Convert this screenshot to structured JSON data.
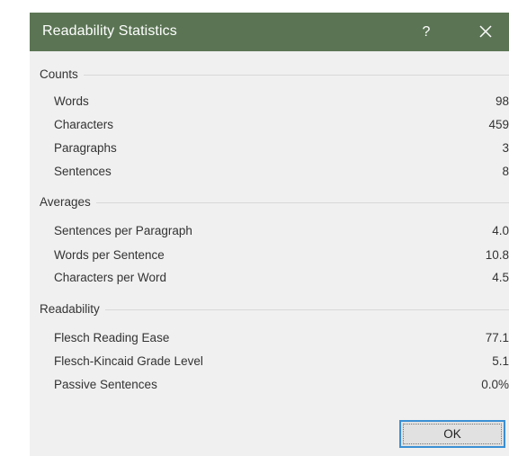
{
  "dialog": {
    "title": "Readability Statistics",
    "help_label": "?",
    "ok_label": "OK"
  },
  "sections": {
    "counts": {
      "heading": "Counts",
      "rows": [
        {
          "label": "Words",
          "value": "98"
        },
        {
          "label": "Characters",
          "value": "459"
        },
        {
          "label": "Paragraphs",
          "value": "3"
        },
        {
          "label": "Sentences",
          "value": "8"
        }
      ]
    },
    "averages": {
      "heading": "Averages",
      "rows": [
        {
          "label": "Sentences per Paragraph",
          "value": "4.0"
        },
        {
          "label": "Words per Sentence",
          "value": "10.8"
        },
        {
          "label": "Characters per Word",
          "value": "4.5"
        }
      ]
    },
    "readability": {
      "heading": "Readability",
      "rows": [
        {
          "label": "Flesch Reading Ease",
          "value": "77.1"
        },
        {
          "label": "Flesch-Kincaid Grade Level",
          "value": "5.1"
        },
        {
          "label": "Passive Sentences",
          "value": "0.0%"
        }
      ]
    }
  },
  "colors": {
    "titlebar": "#5b7554",
    "dialog_background": "#f0f0f0",
    "focus_border": "#3a8fd4"
  },
  "icons": {
    "close": "close-icon"
  }
}
